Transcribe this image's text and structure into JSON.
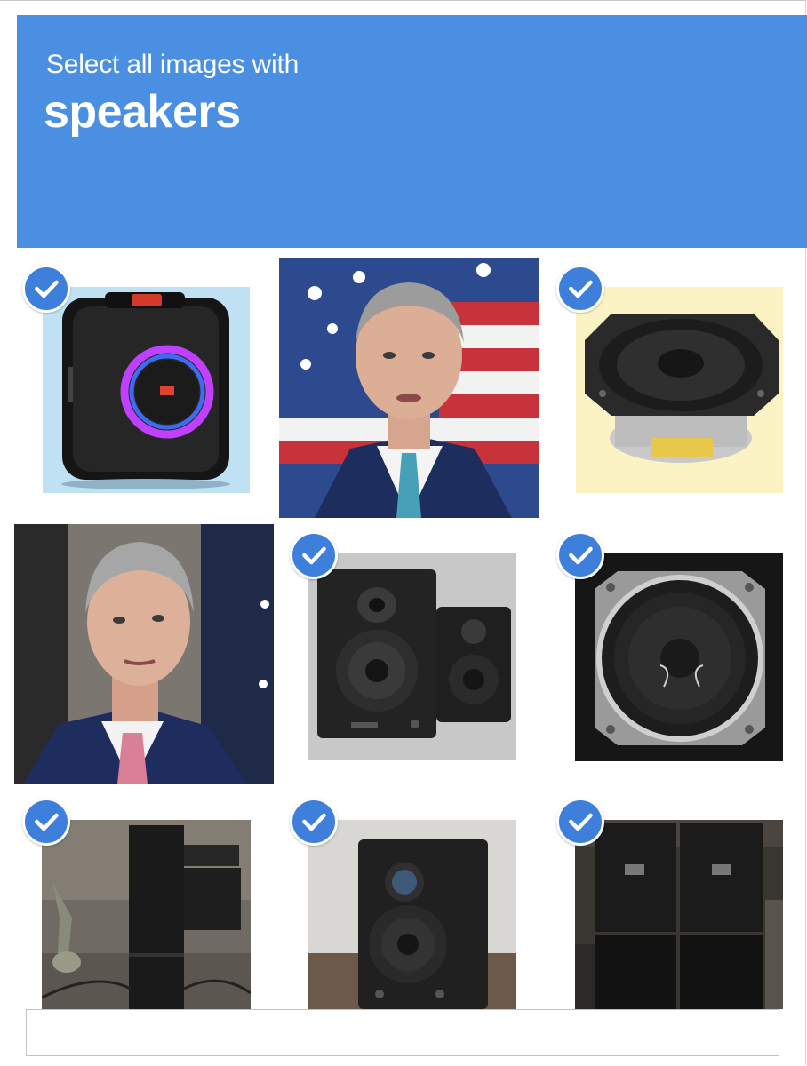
{
  "challenge": {
    "prompt": "Select all images with",
    "target": "speakers",
    "accent_color": "#4a8fe2"
  },
  "tiles": [
    {
      "row": 1,
      "col": 1,
      "content": "portable-party-speaker",
      "selected": true
    },
    {
      "row": 1,
      "col": 2,
      "content": "man-portrait-flag",
      "selected": false
    },
    {
      "row": 1,
      "col": 3,
      "content": "speaker-driver",
      "selected": true
    },
    {
      "row": 2,
      "col": 1,
      "content": "man-portrait",
      "selected": false
    },
    {
      "row": 2,
      "col": 2,
      "content": "studio-monitor-pair",
      "selected": true
    },
    {
      "row": 2,
      "col": 3,
      "content": "speaker-driver",
      "selected": true
    },
    {
      "row": 3,
      "col": 1,
      "content": "tower-speaker",
      "selected": true
    },
    {
      "row": 3,
      "col": 2,
      "content": "studio-monitor",
      "selected": true
    },
    {
      "row": 3,
      "col": 3,
      "content": "stacked-pa-speakers",
      "selected": true
    }
  ]
}
